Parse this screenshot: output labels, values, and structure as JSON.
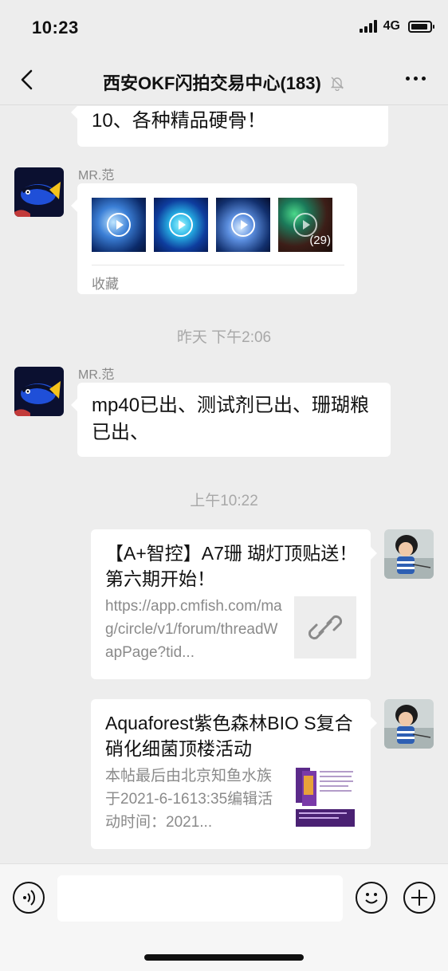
{
  "status_bar": {
    "time": "10:23",
    "network": "4G"
  },
  "nav": {
    "title": "西安OKF闪拍交易中心(183)",
    "back_icon": "chevron-left-icon",
    "mute_icon": "bell-slash-icon",
    "more_icon": "more-dots-icon"
  },
  "messages": {
    "partial_top": {
      "text": "10、各种精品硬骨！"
    },
    "collection": {
      "sender": "MR.范",
      "count_label": "(29)",
      "footer": "收藏"
    },
    "time_1": "昨天 下午2:06",
    "text_msg": {
      "sender": "MR.范",
      "text": "mp40已出、测试剂已出、珊瑚粮已出、"
    },
    "time_2": "上午10:22",
    "link_1": {
      "title": "【A+智控】A7珊 瑚灯顶贴送！第六期开始！",
      "desc": "https://app.cmfish.com/mag/circle/v1/forum/threadWapPage?tid...",
      "thumb_icon": "link-icon"
    },
    "link_2": {
      "title": "Aquaforest紫色森林BIO S复合硝化细菌顶楼活动",
      "desc": "本帖最后由北京知鱼水族于2021-6-1613:35编辑活动时间：2021..."
    }
  },
  "input_bar": {
    "voice_icon": "voice-icon",
    "emoji_icon": "emoji-icon",
    "plus_icon": "plus-icon"
  }
}
